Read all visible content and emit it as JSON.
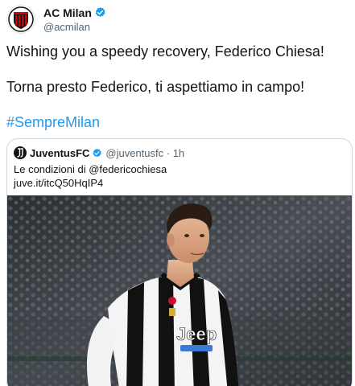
{
  "account": {
    "display_name": "AC Milan",
    "handle": "@acmilan",
    "avatar_icon": "ac-milan-crest-icon",
    "verified_icon": "verified-badge-icon"
  },
  "tweet": {
    "line1": "Wishing you a speedy recovery, Federico Chiesa!",
    "line2": "Torna presto Federico, ti aspettiamo in campo!",
    "hashtag": "#SempreMilan"
  },
  "quoted": {
    "display_name": "JuventusFC",
    "handle_time": "@juventusfc · 1h",
    "text": "Le condizioni di @federicochiesa",
    "link": "juve.it/itcQ50HqIP4",
    "avatar_icon": "juventus-logo-icon",
    "photo_icon": "player-photo-image",
    "shirt_sponsor": "Jeep"
  },
  "colors": {
    "link_blue": "#1d9bf0",
    "verified_blue": "#1d9bf0",
    "border": "#cfd9de",
    "muted_text": "#536471"
  }
}
